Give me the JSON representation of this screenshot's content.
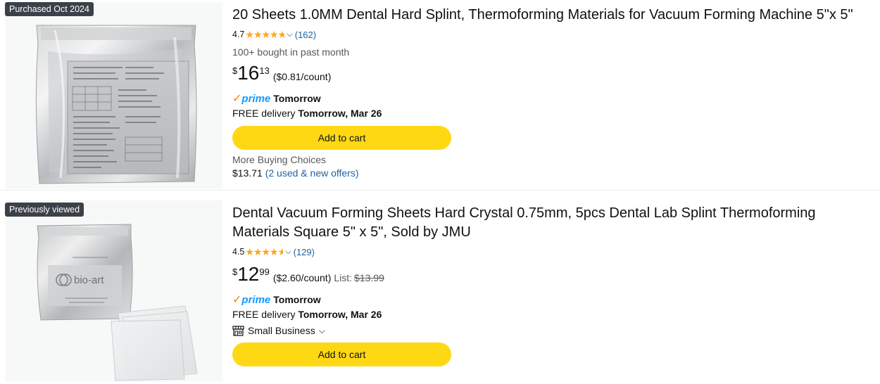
{
  "results": [
    {
      "badge": "Purchased Oct 2024",
      "title": "20 Sheets 1.0MM Dental Hard Splint, Thermoforming Materials for Vacuum Forming Machine 5\"x 5\"",
      "rating": "4.7",
      "stars_value": 4.7,
      "review_count": "(162)",
      "bought": "100+ bought in past month",
      "price": {
        "symbol": "$",
        "whole": "16",
        "fraction": "13",
        "unit": "($0.81/count)"
      },
      "prime": {
        "check": "✓",
        "label": "prime",
        "day": "Tomorrow"
      },
      "delivery": {
        "prefix": "FREE delivery ",
        "date": "Tomorrow, Mar 26"
      },
      "cart_label": "Add to cart",
      "more_buying": "More Buying Choices",
      "more_price": "$13.71",
      "more_offers": "(2 used & new offers)"
    },
    {
      "badge": "Previously viewed",
      "title": "Dental Vacuum Forming Sheets Hard Crystal 0.75mm, 5pcs Dental Lab Splint Thermoforming Materials Square 5\" x 5\", Sold by JMU",
      "rating": "4.5",
      "stars_value": 4.5,
      "review_count": "(129)",
      "price": {
        "symbol": "$",
        "whole": "12",
        "fraction": "99",
        "unit": "($2.60/count)",
        "list_label": "List:",
        "list_price": "$13.99"
      },
      "prime": {
        "check": "✓",
        "label": "prime",
        "day": "Tomorrow"
      },
      "delivery": {
        "prefix": "FREE delivery ",
        "date": "Tomorrow, Mar 26"
      },
      "small_business": "Small Business",
      "cart_label": "Add to cart",
      "brand_logo_text": "bio-art"
    }
  ],
  "colors": {
    "cart_button": "#FFD814",
    "stars": "#FFA41C",
    "link": "#2162a1",
    "prime_blue": "#1399FF",
    "prime_check": "#F08804"
  },
  "icons": [
    "star-icon",
    "chevron-down-icon",
    "prime-check-icon",
    "storefront-icon"
  ]
}
